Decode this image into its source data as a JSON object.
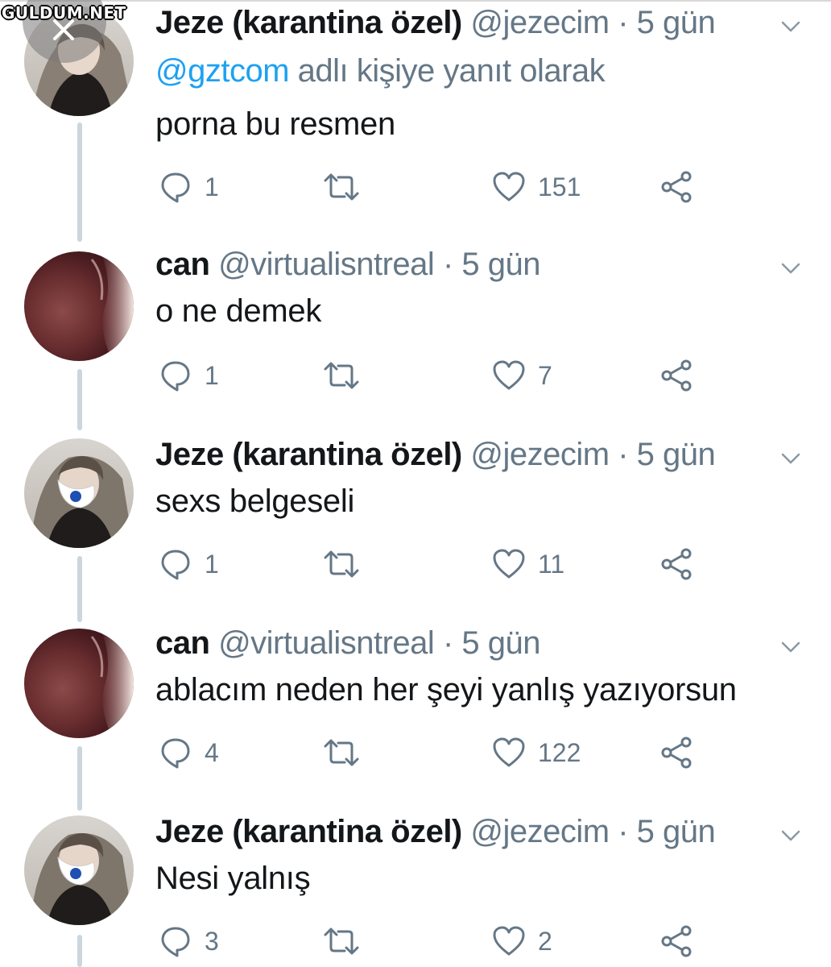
{
  "watermark": {
    "text": "GULDUM.NET",
    "icon": "close-icon"
  },
  "tweets": [
    {
      "author": "Jeze (karantina özel)",
      "handle": "@jezecim",
      "separator": "·",
      "time": "5 gün",
      "avatar": "avatar-jeze",
      "reply_prefix": "@gztcom",
      "reply_suffix": " adlı kişiye yanıt olarak",
      "text": "porna bu resmen",
      "replies": "1",
      "retweets": "",
      "likes": "151"
    },
    {
      "author": "can",
      "handle": "@virtualisntreal",
      "separator": "·",
      "time": "5 gün",
      "avatar": "avatar-can",
      "text": "o ne demek",
      "replies": "1",
      "retweets": "",
      "likes": "7"
    },
    {
      "author": "Jeze (karantina özel)",
      "handle": "@jezecim",
      "separator": "·",
      "time": "5 gün",
      "avatar": "avatar-jeze",
      "text": "sexs belgeseli",
      "replies": "1",
      "retweets": "",
      "likes": "11"
    },
    {
      "author": "can",
      "handle": "@virtualisntreal",
      "separator": "·",
      "time": "5 gün",
      "avatar": "avatar-can",
      "text": "ablacım neden her şeyi yanlış yazıyorsun",
      "replies": "4",
      "retweets": "",
      "likes": "122"
    },
    {
      "author": "Jeze (karantina özel)",
      "handle": "@jezecim",
      "separator": "·",
      "time": "5 gün",
      "avatar": "avatar-jeze",
      "text": "Nesi yalnış",
      "replies": "3",
      "retweets": "",
      "likes": "2"
    }
  ],
  "colors": {
    "text": "#14171a",
    "secondary": "#657786",
    "mention": "#1da1f2",
    "thread_line": "#ccd6dd"
  },
  "icons": [
    "reply-icon",
    "retweet-icon",
    "like-icon",
    "share-icon",
    "chevron-down-icon"
  ]
}
